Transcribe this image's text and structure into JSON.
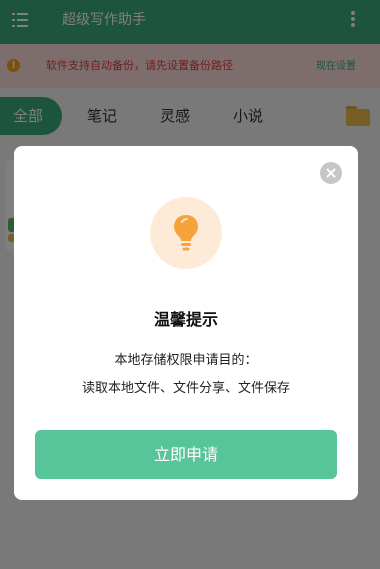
{
  "app_bar": {
    "title": "超级写作助手",
    "menu_icon": "list-menu-icon",
    "more_icon": "more-vertical-icon",
    "color": "#3aa87c"
  },
  "notice": {
    "icon": "warning-icon",
    "text": "软件支持自动备份，请先设置备份路径",
    "action": "现在设置"
  },
  "tabs": {
    "items": [
      {
        "label": "全部",
        "active": true
      },
      {
        "label": "笔记",
        "active": false
      },
      {
        "label": "灵感",
        "active": false
      },
      {
        "label": "小说",
        "active": false
      }
    ],
    "folder_icon": "folder-icon"
  },
  "dialog": {
    "close_icon": "close-icon",
    "icon": "lightbulb-icon",
    "title": "温馨提示",
    "line1": "本地存储权限申请目的：",
    "line2": "读取本地文件、文件分享、文件保存",
    "button": "立即申请",
    "button_color": "#58c49a"
  }
}
